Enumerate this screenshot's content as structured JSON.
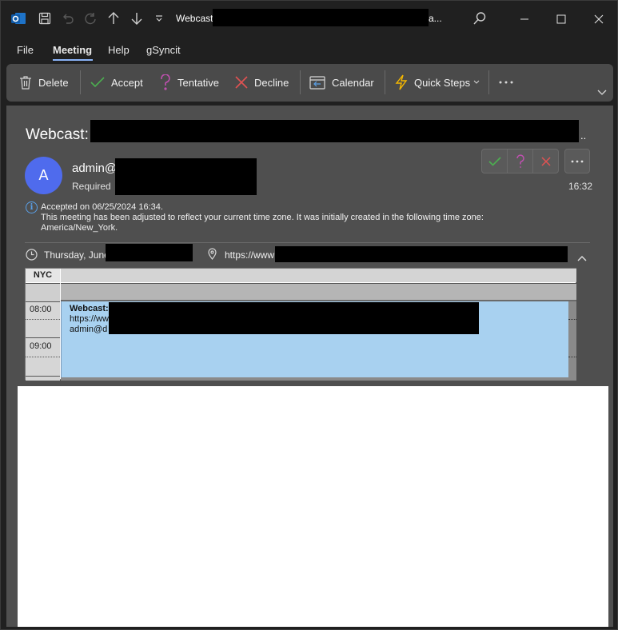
{
  "titlebar": {
    "title": "Webcast",
    "title_suffix": "a..."
  },
  "menu": {
    "tabs": [
      "File",
      "Meeting",
      "Help",
      "gSyncit"
    ]
  },
  "ribbon": {
    "delete": "Delete",
    "accept": "Accept",
    "tentative": "Tentative",
    "decline": "Decline",
    "calendar": "Calendar",
    "quick_steps": "Quick Steps"
  },
  "message": {
    "subject": "Webcast:",
    "subject_suffix": "..",
    "avatar_initial": "A",
    "sender": "admin@",
    "attendance": "Required",
    "time": "16:32",
    "info_line1": "Accepted on 06/25/2024 16:34.",
    "info_line2": "This meeting has been adjusted to reflect your current time zone. It was initially created in the following time zone:",
    "info_line3": "America/New_York.",
    "when": "Thursday, June",
    "location": "https://www"
  },
  "calendar_preview": {
    "timezone_label": "NYC",
    "hours": [
      "08:00",
      "09:00"
    ],
    "event_title": "Webcast:",
    "event_location": "https://ww",
    "event_organizer": "admin@d"
  },
  "colors": {
    "accent": "#8ab4f8",
    "avatar": "#4f6bed",
    "event": "#a8d1f0",
    "accept": "#4caf50",
    "tentative": "#b14ba0",
    "decline": "#e05252",
    "quick_steps": "#f5b700"
  }
}
